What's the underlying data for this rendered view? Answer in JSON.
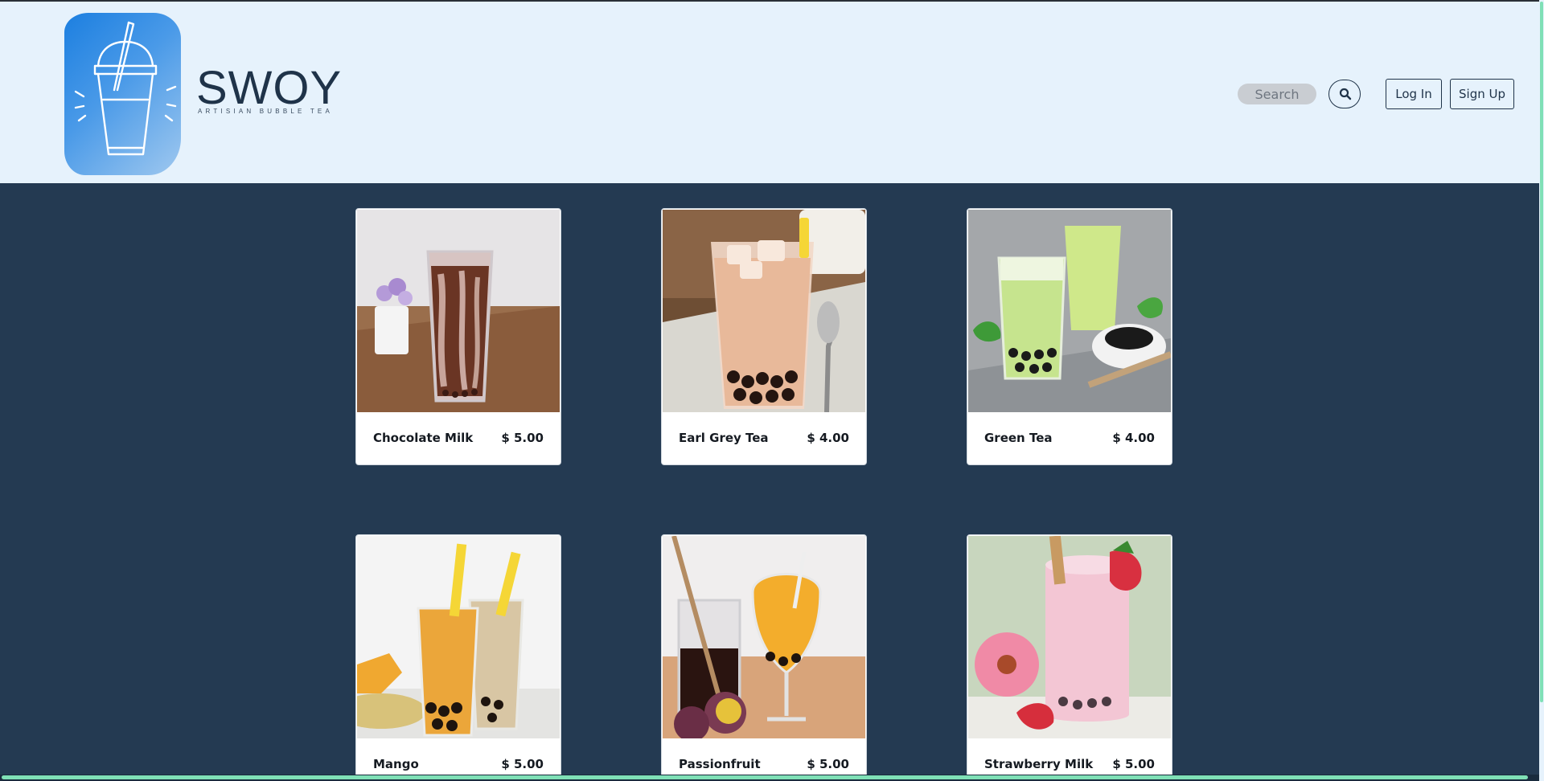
{
  "brand": {
    "name": "SWOY",
    "tagline": "ARTISIAN BUBBLE TEA",
    "logo_icon": "bubble-tea-cup-icon",
    "logo_color": "#1c7fe0"
  },
  "header": {
    "search_placeholder": "Search",
    "search_icon": "magnifier-icon",
    "login_label": "Log In",
    "signup_label": "Sign Up"
  },
  "products": [
    {
      "name": "Chocolate Milk",
      "price": "$ 5.00",
      "image": "chocolate-milk-photo"
    },
    {
      "name": "Earl Grey Tea",
      "price": "$ 4.00",
      "image": "earl-grey-tea-photo"
    },
    {
      "name": "Green Tea",
      "price": "$ 4.00",
      "image": "green-tea-photo"
    },
    {
      "name": "Mango",
      "price": "$ 5.00",
      "image": "mango-photo"
    },
    {
      "name": "Passionfruit",
      "price": "$ 5.00",
      "image": "passionfruit-photo"
    },
    {
      "name": "Strawberry Milk",
      "price": "$ 5.00",
      "image": "strawberry-milk-photo"
    }
  ],
  "colors": {
    "header_background": "#e6f2fc",
    "page_background": "#243a52",
    "text_dark": "#1f3349",
    "scrollbar_accent": "#7fe0b6"
  }
}
